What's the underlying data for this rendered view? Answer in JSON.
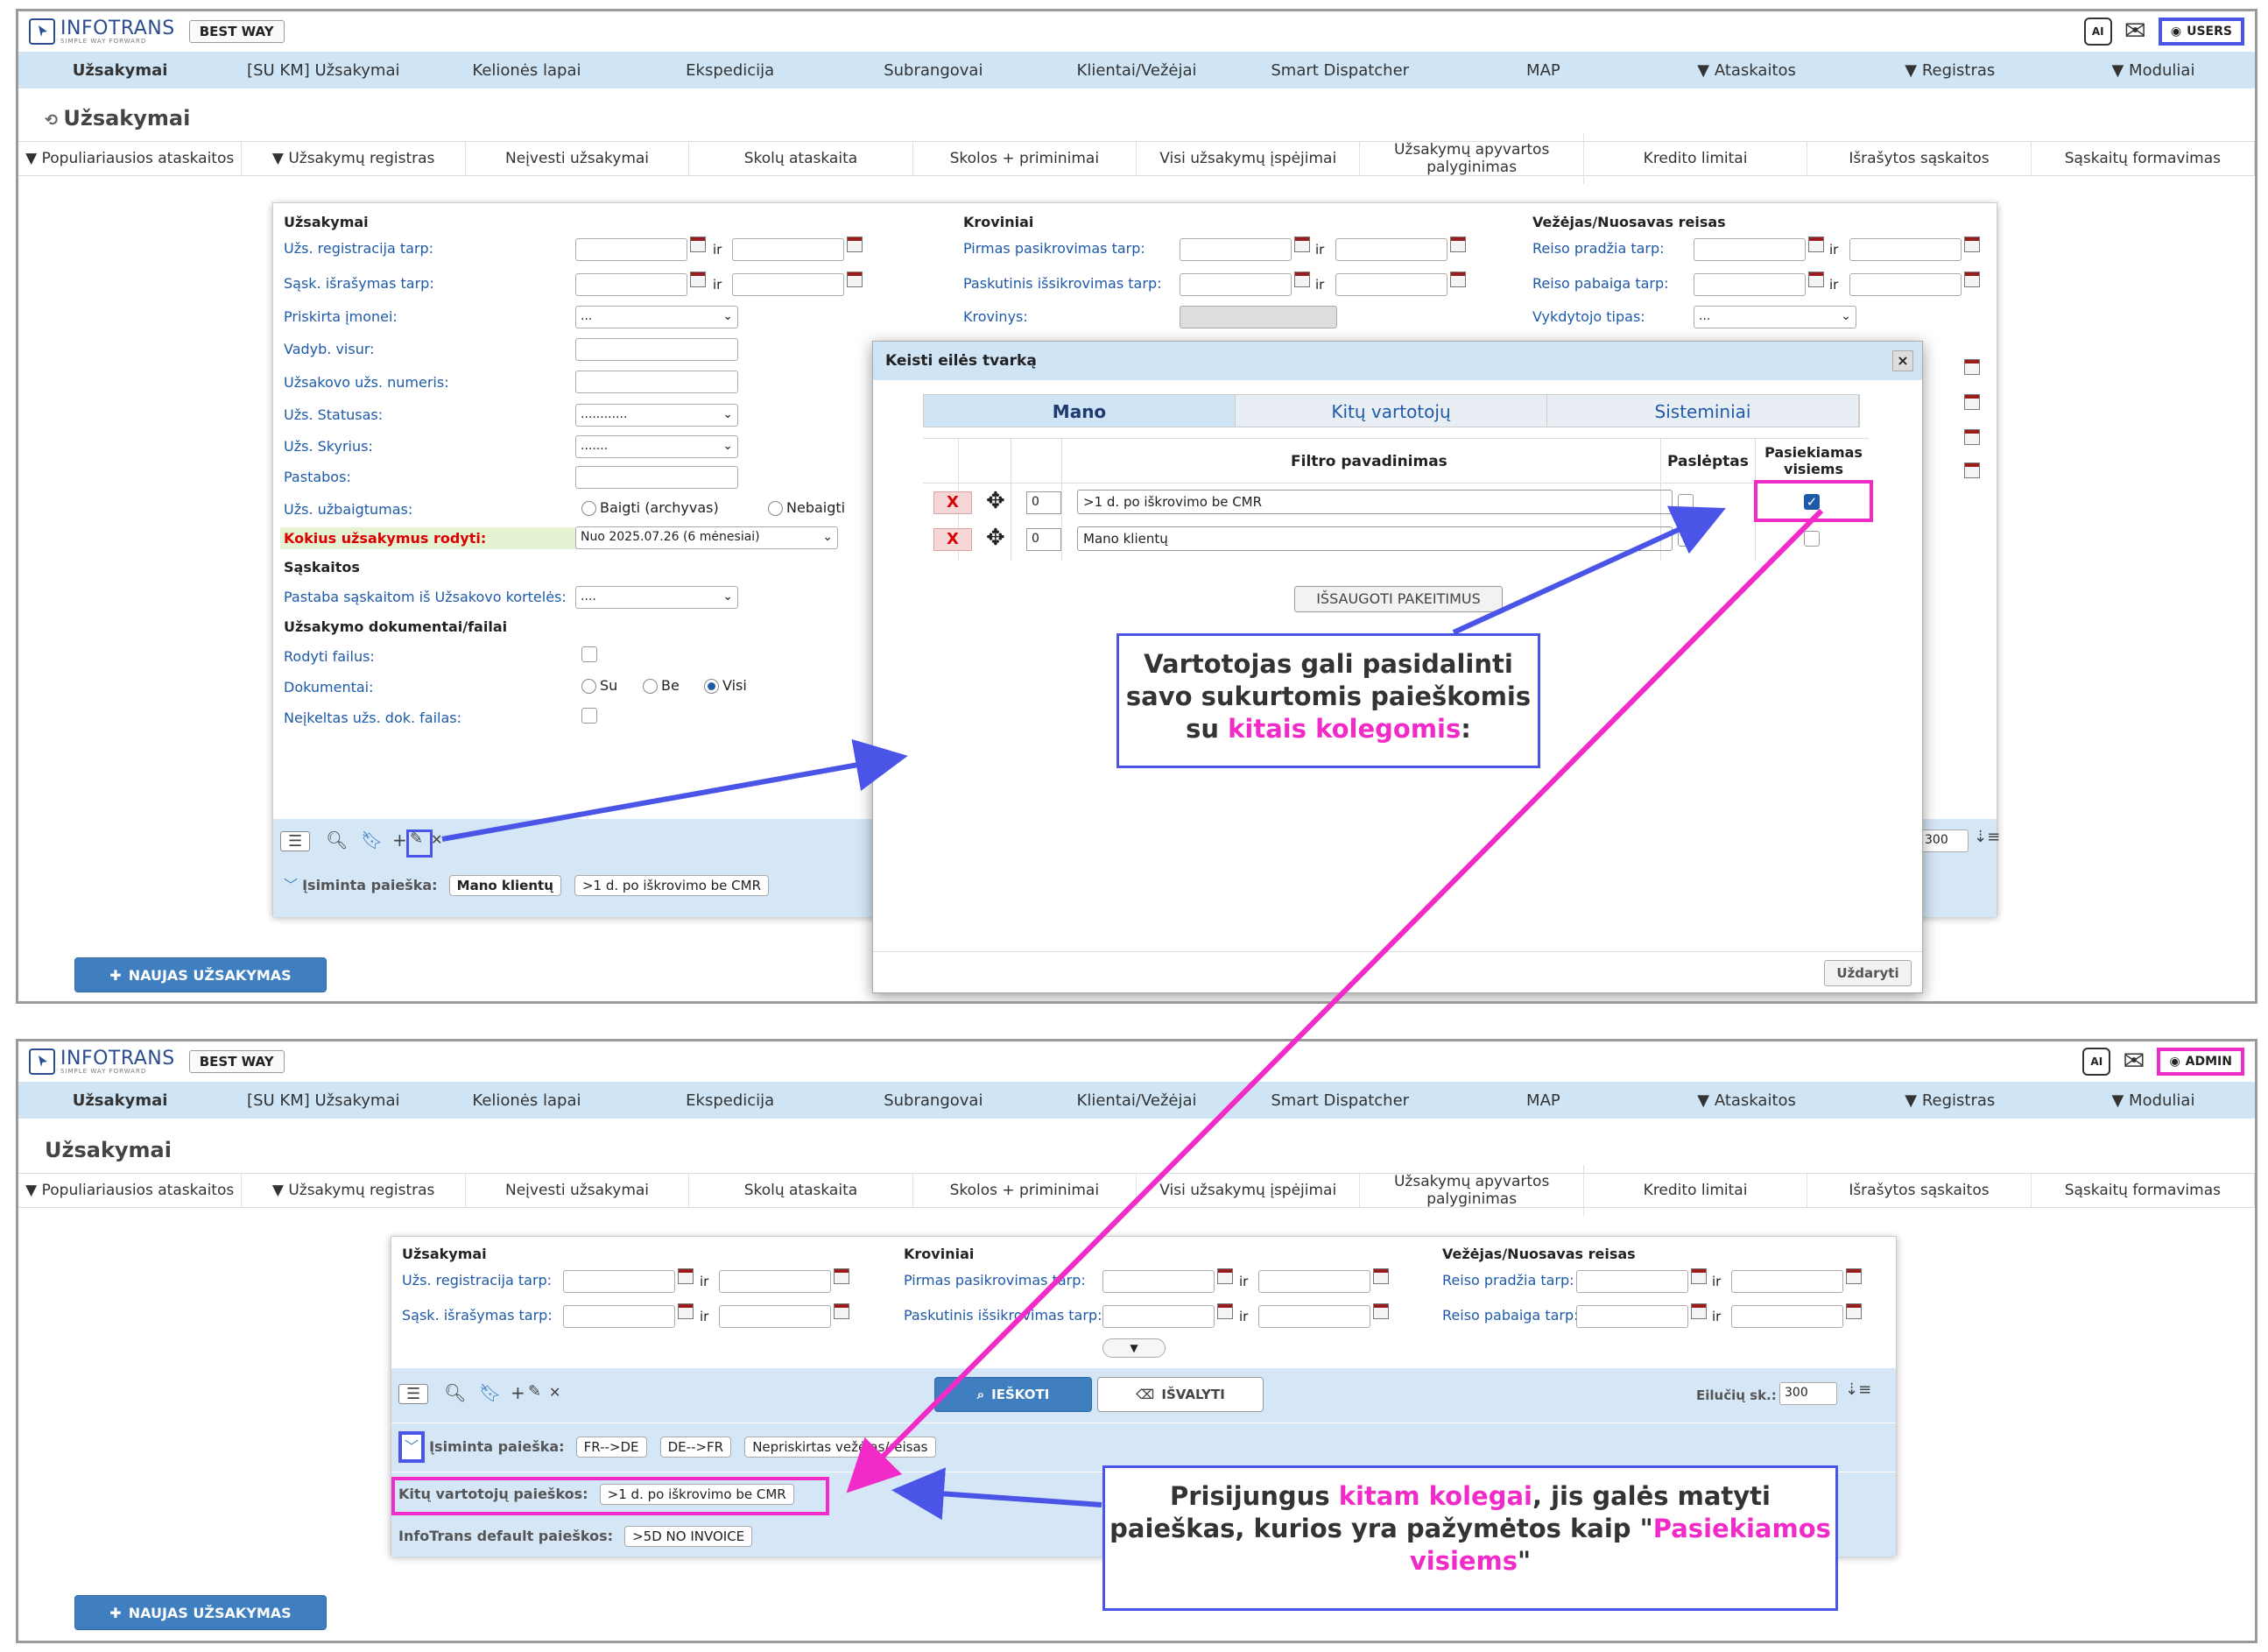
{
  "brand": {
    "logo": "INFOTRANS",
    "tagline": "SIMPLE WAY FORWARD",
    "company": "BEST WAY"
  },
  "icons": {
    "ai": "AI",
    "mail": "mail-icon",
    "user": "user-icon"
  },
  "nav": [
    "Užsakymai",
    "[SU KM] Užsakymai",
    "Kelionės lapai",
    "Ekspedicija",
    "Subrangovai",
    "Klientai/Vežėjai",
    "Smart Dispatcher",
    "MAP",
    "▼ Ataskaitos",
    "▼ Registras",
    "▼ Moduliai"
  ],
  "tabs2": [
    "▼ Populiariausios ataskaitos",
    "▼ Užsakymų registras",
    "Neįvesti užsakymai",
    "Skolų ataskaita",
    "Skolos + priminimai",
    "Visi užsakymų įspėjimai",
    "Užsakymų apyvartos palyginimas",
    "Kredito limitai",
    "Išrašytos sąskaitos",
    "Sąskaitų formavimas"
  ],
  "panel1": {
    "user": "USERS",
    "page_title": "Užsakymai",
    "form": {
      "col1_title": "Užsakymai",
      "labels": [
        "Užs. registracija tarp:",
        "Sąsk. išrašymas tarp:",
        "Priskirta įmonei:",
        "Vadyb. visur:",
        "Užsakovo užs. numeris:",
        "Užs. Statusas:",
        "Užs. Skyrius:",
        "Pastabos:",
        "Užs. užbaigtumas:"
      ],
      "ir": "ir",
      "select_priskirta": "...",
      "select_statusas": "............",
      "select_skyrius": ".......",
      "radio_archyvas": "Baigti (archyvas)",
      "radio_nebaigti": "Nebaigti",
      "kokius_label": "Kokius užsakymus rodyti:",
      "kokius_value": "Nuo 2025.07.26 (6 mėnesiai)",
      "saskaitos_title": "Sąskaitos",
      "pastaba_label": "Pastaba sąskaitom iš Užsakovo kortelės:",
      "pastaba_value": "....",
      "docs_title": "Užsakymo dokumentai/failai",
      "rodyti_failus": "Rodyti failus:",
      "dokumentai": "Dokumentai:",
      "su": "Su",
      "be": "Be",
      "visi": "Visi",
      "neikeltas": "Neįkeltas užs. dok. failas:",
      "col2_title": "Kroviniai",
      "col2_labels": [
        "Pirmas pasikrovimas tarp:",
        "Paskutinis išsikrovimas tarp:",
        "Krovinys:"
      ],
      "col3_title": "Vežėjas/Nuosavas reisas",
      "col3_labels": [
        "Reiso pradžia tarp:",
        "Reiso pabaiga tarp:",
        "Vykdytojo tipas:"
      ],
      "vykdytojo_value": "...",
      "rows_value": "300",
      "isiminta_label": "Įsiminta paieška:",
      "isiminta_chips": [
        "Mano klientų",
        ">1 d. po iškrovimo be CMR"
      ]
    },
    "new_order": "NAUJAS UŽSAKYMAS",
    "modal": {
      "title": "Keisti eilės tvarką",
      "close": "×",
      "tabs": [
        "Mano",
        "Kitų vartotojų",
        "Sisteminiai"
      ],
      "col_name": "Filtro pavadinimas",
      "col_hidden": "Paslėptas",
      "col_shared": "Pasiekiamas visiems",
      "rows": [
        {
          "x": "X",
          "order": "0",
          "name": ">1 d. po iškrovimo be CMR",
          "hidden": false,
          "shared": true
        },
        {
          "x": "X",
          "order": "0",
          "name": "Mano klientų",
          "hidden": false,
          "shared": false
        }
      ],
      "save": "IŠSAUGOTI PAKEITIMUS",
      "close_btn": "Uždaryti"
    },
    "callout": {
      "line1": "Vartotojas gali pasidalinti",
      "line2": "savo sukurtomis paieškomis",
      "line3a": "su ",
      "line3b": "kitais kolegomis",
      "line3c": ":"
    }
  },
  "panel2": {
    "user": "ADMIN",
    "page_title": "Užsakymai",
    "form": {
      "col1_title": "Užsakymai",
      "col1_labels": [
        "Užs. registracija tarp:",
        "Sąsk. išrašymas tarp:"
      ],
      "col2_title": "Kroviniai",
      "col2_labels": [
        "Pirmas pasikrovimas tarp:",
        "Paskutinis išsikrovimas tarp:"
      ],
      "col3_title": "Vežėjas/Nuosavas reisas",
      "col3_labels": [
        "Reiso pradžia tarp:",
        "Reiso pabaiga tarp:"
      ],
      "ir": "ir",
      "search": "IEŠKOTI",
      "clear": "IŠVALYTI",
      "rows_label": "Eilučių sk.:",
      "rows_value": "300",
      "isiminta_label": "Įsiminta paieška:",
      "isiminta_chips": [
        "FR-->DE",
        "DE-->FR",
        "Nepriskirtas vežėjas/reisas"
      ],
      "kitu_label": "Kitų vartotojų paieškos:",
      "kitu_chip": ">1 d. po iškrovimo be CMR",
      "default_label": "InfoTrans default paieškos:",
      "default_chip": ">5D NO INVOICE"
    },
    "new_order": "NAUJAS UŽSAKYMAS",
    "callout": {
      "a": "Prisijungus ",
      "b": "kitam kolegai",
      "c": ", jis galės matyti paieškas, kurios yra pažymėtos kaip \"",
      "d": "Pasiekiamos visiems",
      "e": "\""
    }
  },
  "colors": {
    "nav_bg": "#cfe4f5",
    "accent_blue": "#4a55e8",
    "accent_pink": "#f02bc8",
    "button_blue": "#3f7fc0"
  }
}
